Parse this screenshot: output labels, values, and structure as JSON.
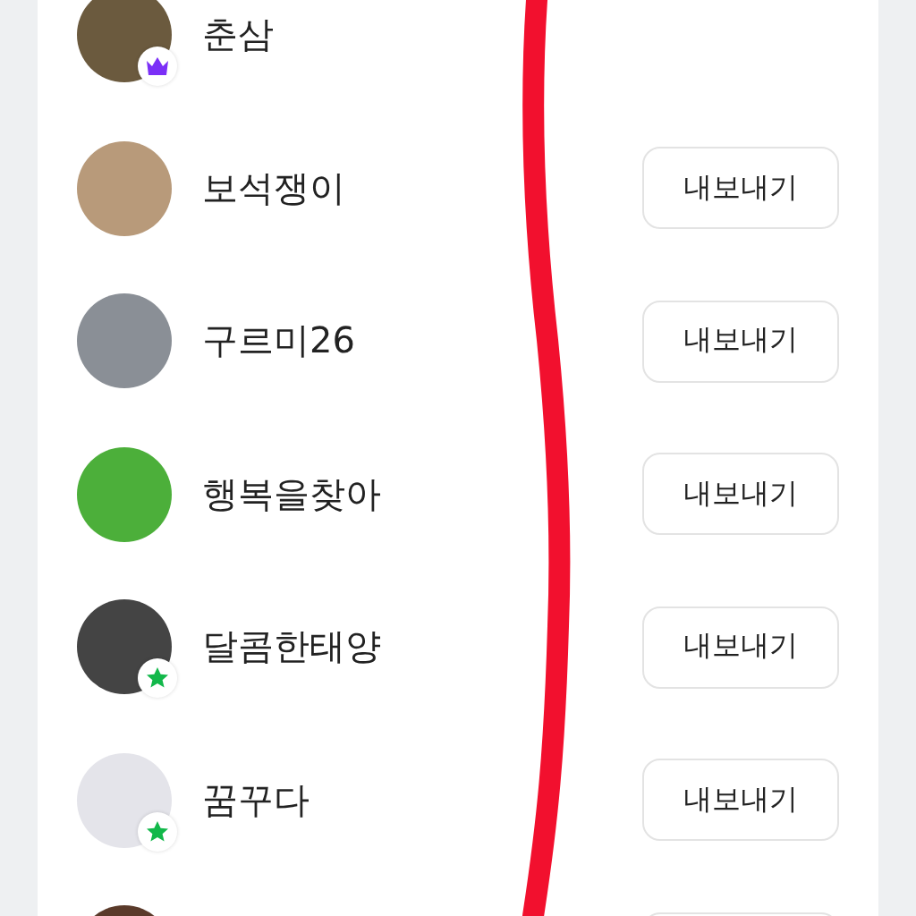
{
  "members": [
    {
      "name": "춘삼",
      "kind": "crown"
    },
    {
      "name": "보석쟁이",
      "kind": "plain",
      "button": "내보내기"
    },
    {
      "name": "구르미26",
      "kind": "plain",
      "button": "내보내기"
    },
    {
      "name": "행복을찾아",
      "kind": "plain",
      "button": "내보내기"
    },
    {
      "name": "달콤한태양",
      "kind": "star",
      "button": "내보내기"
    },
    {
      "name": "꿈꾸다",
      "kind": "star",
      "button": "내보내기"
    }
  ],
  "more_below": true,
  "marker_stroke": true
}
